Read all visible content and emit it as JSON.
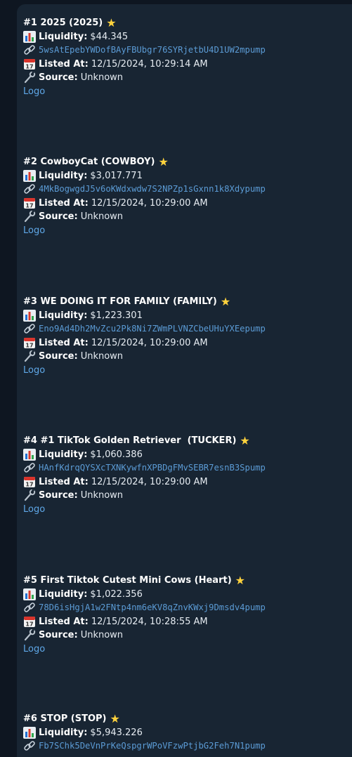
{
  "colors": {
    "background": "#0e1621",
    "bubble": "#182533",
    "text": "#e6ecf2",
    "mint_link": "#5b9bd5",
    "logo_link": "#5fa8e8",
    "star": "#ffd23d"
  },
  "labels": {
    "liquidity": "Liquidity:",
    "listed_at": "Listed At:",
    "source": "Source:",
    "logo": "Logo"
  },
  "icons": {
    "title": "star-icon",
    "liquidity": "bar-chart-icon",
    "mint": "link-icon",
    "listed": "calendar-icon",
    "source": "wrench-icon"
  },
  "tokens": [
    {
      "title": "#1 2025 (2025)",
      "liquidity": "$44.345",
      "mint": "5wsAtEpebYWDofBAyFBUbgr76SYRjetbU4D1UW2mpump",
      "listed_at": "12/15/2024, 10:29:14 AM",
      "source": "Unknown"
    },
    {
      "title": "#2 CowboyCat (COWBOY)",
      "liquidity": "$3,017.771",
      "mint": "4MkBogwgdJ5v6oKWdxwdw7S2NPZp1sGxnn1k8Xdypump",
      "listed_at": "12/15/2024, 10:29:00 AM",
      "source": "Unknown"
    },
    {
      "title": "#3 WE DOING IT FOR FAMILY (FAMILY)",
      "liquidity": "$1,223.301",
      "mint": "Eno9Ad4Dh2MvZcu2Pk8Ni7ZWmPLVNZCbeUHuYXEepump",
      "listed_at": "12/15/2024, 10:29:00 AM",
      "source": "Unknown"
    },
    {
      "title": "#4 #1 TikTok Golden Retriever  (TUCKER)",
      "liquidity": "$1,060.386",
      "mint": "HAnfKdrqQYSXcTXNKywfnXPBDgFMvSEBR7esnB3Spump",
      "listed_at": "12/15/2024, 10:29:00 AM",
      "source": "Unknown"
    },
    {
      "title": "#5 First Tiktok Cutest Mini Cows (Heart)",
      "liquidity": "$1,022.356",
      "mint": "78D6isHgjA1w2FNtp4nm6eKV8qZnvKWxj9Dmsdv4pump",
      "listed_at": "12/15/2024, 10:28:55 AM",
      "source": "Unknown"
    },
    {
      "title": "#6 STOP (STOP)",
      "liquidity": "$5,943.226",
      "mint": "Fb7SChk5DeVnPrKeQspgrWPoVFzwPtjbG2Feh7N1pump"
    }
  ]
}
